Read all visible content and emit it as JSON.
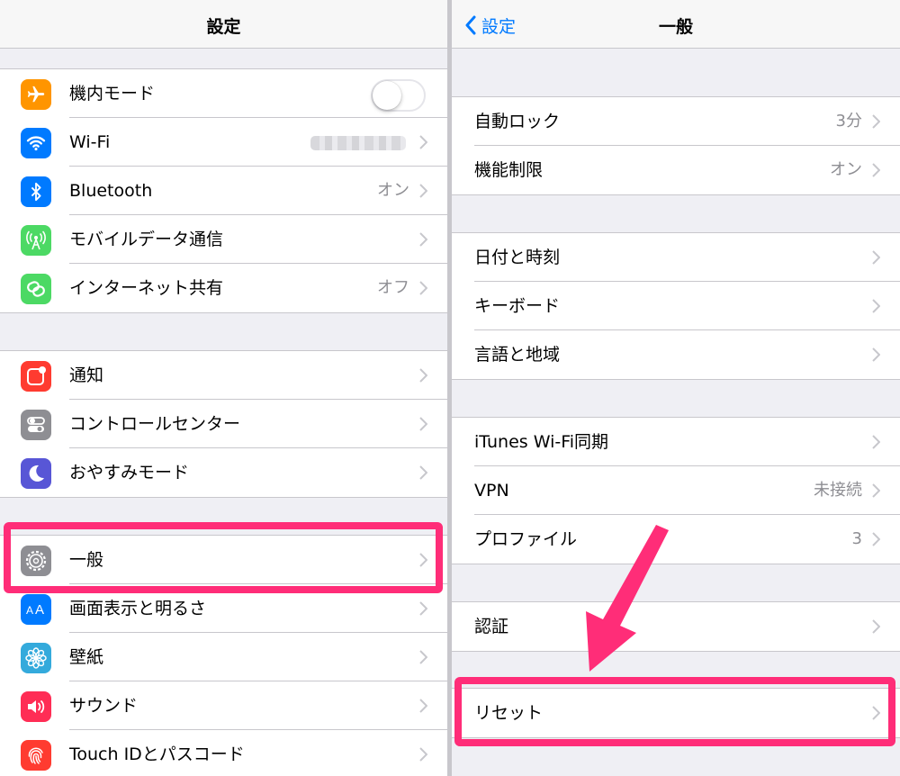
{
  "left": {
    "title": "設定",
    "groups": [
      [
        {
          "label": "機内モード",
          "icon": "airplane-icon",
          "color": "#ff9500",
          "toggle": "off"
        },
        {
          "label": "Wi-Fi",
          "icon": "wifi-icon",
          "color": "#007aff",
          "value": "",
          "blurred": true
        },
        {
          "label": "Bluetooth",
          "icon": "bluetooth-icon",
          "color": "#007aff",
          "value": "オン"
        },
        {
          "label": "モバイルデータ通信",
          "icon": "cellular-antenna-icon",
          "color": "#4cd964",
          "value": ""
        },
        {
          "label": "インターネット共有",
          "icon": "hotspot-link-icon",
          "color": "#4cd964",
          "value": "オフ"
        }
      ],
      [
        {
          "label": "通知",
          "icon": "notifications-icon",
          "color": "#ff3b30",
          "value": ""
        },
        {
          "label": "コントロールセンター",
          "icon": "control-center-icon",
          "color": "#8e8e93",
          "value": ""
        },
        {
          "label": "おやすみモード",
          "icon": "moon-icon",
          "color": "#5856d6",
          "value": ""
        }
      ],
      [
        {
          "label": "一般",
          "icon": "gear-icon",
          "color": "#8e8e93",
          "value": "",
          "highlighted": true
        },
        {
          "label": "画面表示と明るさ",
          "icon": "text-size-icon",
          "color": "#007aff",
          "value": ""
        },
        {
          "label": "壁紙",
          "icon": "flower-wallpaper-icon",
          "color": "#34aadc",
          "value": ""
        },
        {
          "label": "サウンド",
          "icon": "speaker-icon",
          "color": "#ff2d55",
          "value": ""
        },
        {
          "label": "Touch IDとパスコード",
          "icon": "fingerprint-icon",
          "color": "#ff3b30",
          "value": ""
        }
      ]
    ]
  },
  "right": {
    "back_label": "設定",
    "title": "一般",
    "groups": [
      [
        {
          "label": "自動ロック",
          "value": "3分"
        },
        {
          "label": "機能制限",
          "value": "オン"
        }
      ],
      [
        {
          "label": "日付と時刻",
          "value": ""
        },
        {
          "label": "キーボード",
          "value": ""
        },
        {
          "label": "言語と地域",
          "value": ""
        }
      ],
      [
        {
          "label": "iTunes Wi-Fi同期",
          "value": ""
        },
        {
          "label": "VPN",
          "value": "未接続"
        },
        {
          "label": "プロファイル",
          "value": "3"
        }
      ],
      [
        {
          "label": "認証",
          "value": ""
        }
      ],
      [
        {
          "label": "リセット",
          "value": "",
          "highlighted": true
        }
      ]
    ]
  },
  "colors": {
    "highlight": "#ff2d78",
    "link": "#007aff",
    "secondary_text": "#8e8e93",
    "background": "#efeff4"
  }
}
